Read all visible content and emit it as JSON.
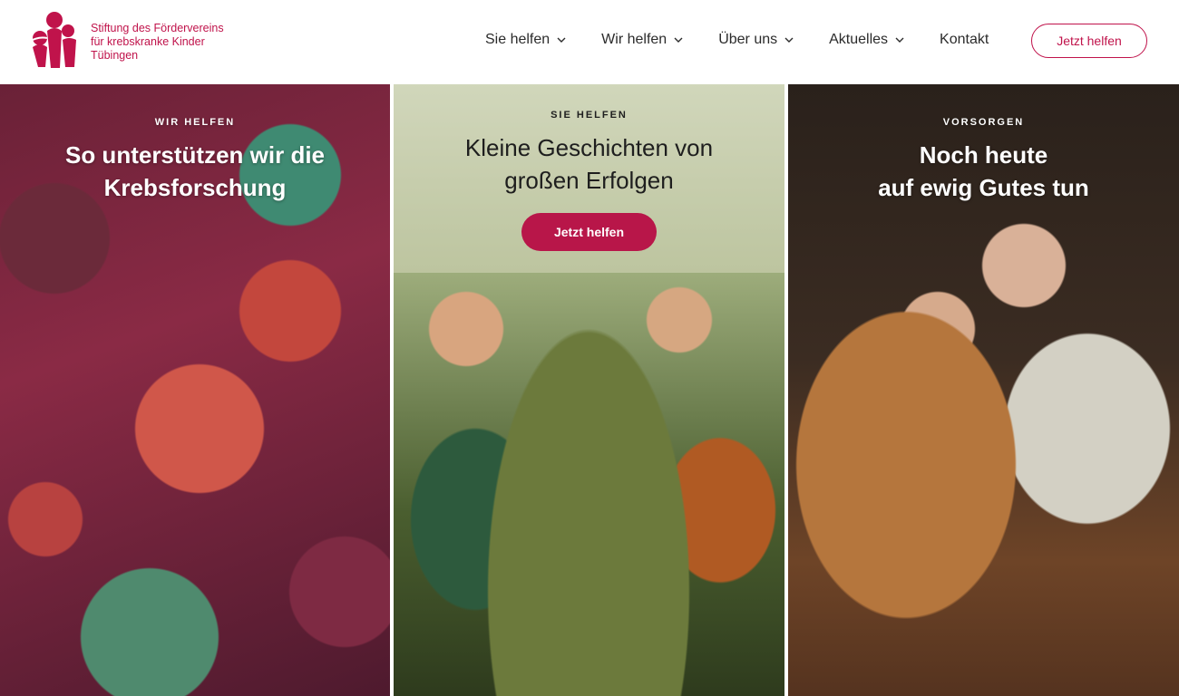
{
  "brand": {
    "line1": "Stiftung des Fördervereins",
    "line2": "für krebskranke Kinder",
    "line3": "Tübingen",
    "color": "#c0134b"
  },
  "nav": {
    "items": [
      {
        "label": "Sie helfen",
        "dropdown": true
      },
      {
        "label": "Wir helfen",
        "dropdown": true
      },
      {
        "label": "Über uns",
        "dropdown": true
      },
      {
        "label": "Aktuelles",
        "dropdown": true
      },
      {
        "label": "Kontakt",
        "dropdown": false
      }
    ],
    "cta_label": "Jetzt helfen"
  },
  "panels": [
    {
      "eyebrow": "WIR HELFEN",
      "line1": "So unterstützen wir die",
      "line2": "Krebsforschung"
    },
    {
      "eyebrow": "SIE HELFEN",
      "line1": "Kleine Geschichten von",
      "line2": "großen Erfolgen",
      "cta_label": "Jetzt helfen"
    },
    {
      "eyebrow": "VORSORGEN",
      "line1": "Noch heute",
      "line2": "auf ewig Gutes tun"
    }
  ],
  "icons": {
    "logo": "family-figures-logo",
    "chevron": "chevron-down-icon"
  }
}
